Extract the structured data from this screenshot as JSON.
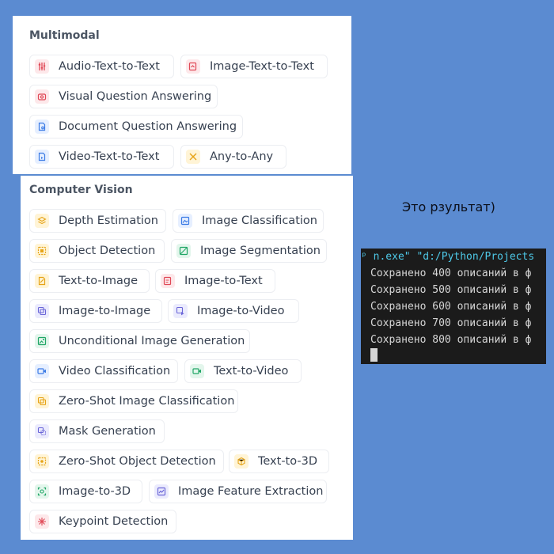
{
  "multimodal": {
    "title": "Multimodal",
    "tasks": [
      {
        "label": "Audio-Text-to-Text",
        "icon": "audio-sliders-icon",
        "color": "red"
      },
      {
        "label": "Image-Text-to-Text",
        "icon": "image-text-icon",
        "color": "red"
      },
      {
        "label": "Visual Question Answering",
        "icon": "visual-qa-icon",
        "color": "red"
      },
      {
        "label": "Document Question Answering",
        "icon": "document-qa-icon",
        "color": "blue"
      },
      {
        "label": "Video-Text-to-Text",
        "icon": "video-text-icon",
        "color": "blue"
      },
      {
        "label": "Any-to-Any",
        "icon": "any-to-any-icon",
        "color": "yellow"
      }
    ]
  },
  "computer_vision": {
    "title": "Computer Vision",
    "tasks": [
      {
        "label": "Depth Estimation",
        "icon": "layers-icon",
        "color": "yellow"
      },
      {
        "label": "Image Classification",
        "icon": "image-classification-icon",
        "color": "blue"
      },
      {
        "label": "Object Detection",
        "icon": "object-detection-icon",
        "color": "yellow"
      },
      {
        "label": "Image Segmentation",
        "icon": "image-segmentation-icon",
        "color": "green"
      },
      {
        "label": "Text-to-Image",
        "icon": "text-to-image-icon",
        "color": "yellow"
      },
      {
        "label": "Image-to-Text",
        "icon": "image-to-text-icon",
        "color": "red"
      },
      {
        "label": "Image-to-Image",
        "icon": "image-to-image-icon",
        "color": "indigo"
      },
      {
        "label": "Image-to-Video",
        "icon": "image-to-video-icon",
        "color": "indigo"
      },
      {
        "label": "Unconditional Image Generation",
        "icon": "image-generation-icon",
        "color": "green"
      },
      {
        "label": "Video Classification",
        "icon": "video-classification-icon",
        "color": "blue"
      },
      {
        "label": "Text-to-Video",
        "icon": "text-to-video-icon",
        "color": "green"
      },
      {
        "label": "Zero-Shot Image Classification",
        "icon": "zero-shot-image-icon",
        "color": "yellow"
      },
      {
        "label": "Mask Generation",
        "icon": "mask-generation-icon",
        "color": "indigo"
      },
      {
        "label": "Zero-Shot Object Detection",
        "icon": "zero-shot-detection-icon",
        "color": "yellow"
      },
      {
        "label": "Text-to-3D",
        "icon": "text-to-3d-icon",
        "color": "yellow"
      },
      {
        "label": "Image-to-3D",
        "icon": "image-to-3d-icon",
        "color": "green"
      },
      {
        "label": "Image Feature Extraction",
        "icon": "feature-extraction-icon",
        "color": "indigo"
      },
      {
        "label": "Keypoint Detection",
        "icon": "keypoint-icon",
        "color": "red"
      }
    ]
  },
  "result_text": "Это рзультат)",
  "terminal": {
    "command": "ᵖ n.exe\" \"d:/Python/Projects",
    "lines": [
      "Сохранено 400 описаний в ф",
      "Сохранено 500 описаний в ф",
      "Сохранено 600 описаний в ф",
      "Сохранено 700 описаний в ф",
      "Сохранено 800 описаний в ф"
    ]
  },
  "colors": {
    "background": "#5b8bd1",
    "terminal_bg": "#1b1b1b",
    "terminal_cmd": "#4ec9e8",
    "terminal_text": "#d6d6d6"
  }
}
